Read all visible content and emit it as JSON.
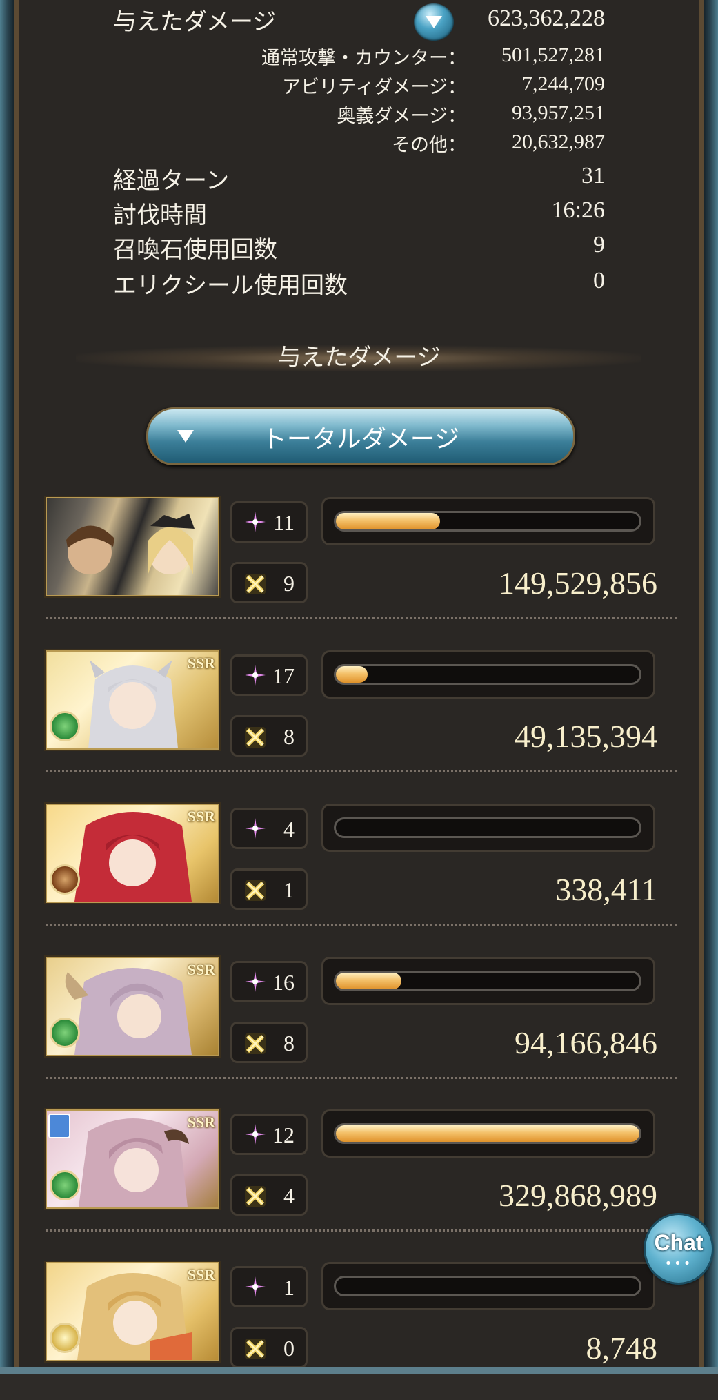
{
  "colors": {
    "panel_bg": "#2a2724",
    "frame_blue": "#4f7f90",
    "bar_gold": "#f4c16a",
    "text_cream": "#f5f1e6"
  },
  "summary": {
    "total_label": "与えたダメージ",
    "total_value": "623,362,228",
    "breakdown": [
      {
        "label": "通常攻撃・カウンター：",
        "value": "501,527,281"
      },
      {
        "label": "アビリティダメージ：",
        "value": "7,244,709"
      },
      {
        "label": "奥義ダメージ：",
        "value": "93,957,251"
      },
      {
        "label": "その他：",
        "value": "20,632,987"
      }
    ],
    "stats": [
      {
        "label": "経過ターン",
        "value": "31"
      },
      {
        "label": "討伐時間",
        "value": "16:26"
      },
      {
        "label": "召喚石使用回数",
        "value": "9"
      },
      {
        "label": "エリクシール使用回数",
        "value": "0"
      }
    ]
  },
  "section_title": "与えたダメージ",
  "dropdown": {
    "label": "トータルダメージ"
  },
  "icons": {
    "expand": "chevron-down-icon",
    "ability": "star-sparkle-icon",
    "charge_attack": "crossed-swords-icon",
    "wind_element": "wind-element-icon",
    "fire_element": "fire-element-icon",
    "light_element": "light-element-icon",
    "accessory": "ring-icon"
  },
  "members": [
    {
      "ssr": "",
      "ability_uses": "11",
      "ca_uses": "9",
      "damage": "149,529,856",
      "bar_fraction": 0.344
    },
    {
      "ssr": "SSR",
      "ability_uses": "17",
      "ca_uses": "8",
      "damage": "49,135,394",
      "bar_fraction": 0.105
    },
    {
      "ssr": "SSR",
      "ability_uses": "4",
      "ca_uses": "1",
      "damage": "338,411",
      "bar_fraction": 0.0
    },
    {
      "ssr": "SSR",
      "ability_uses": "16",
      "ca_uses": "8",
      "damage": "94,166,846",
      "bar_fraction": 0.216
    },
    {
      "ssr": "SSR",
      "ability_uses": "12",
      "ca_uses": "4",
      "damage": "329,868,989",
      "bar_fraction": 1.0
    },
    {
      "ssr": "SSR",
      "ability_uses": "1",
      "ca_uses": "0",
      "damage": "8,748",
      "bar_fraction": 0.0
    }
  ],
  "chat": {
    "label": "Chat",
    "dots": "•••"
  }
}
